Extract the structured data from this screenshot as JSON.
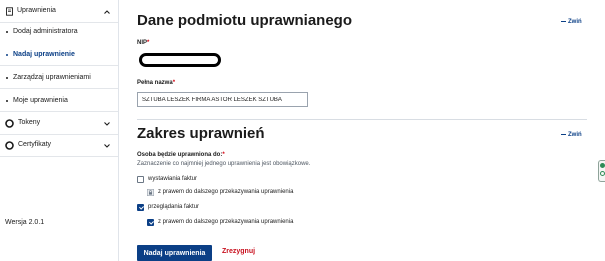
{
  "sidebar": {
    "header_label": "Uprawnienia",
    "items": [
      {
        "label": "Dodaj administratora"
      },
      {
        "label": "Nadaj uprawnienie"
      },
      {
        "label": "Zarządzaj uprawnieniami"
      },
      {
        "label": "Moje uprawnienia"
      }
    ],
    "active_item": "Nadaj uprawnienie",
    "groups": [
      {
        "label": "Tokeny",
        "icon": "circle-icon"
      },
      {
        "label": "Certyfikaty",
        "icon": "circle-icon"
      }
    ],
    "version": "Wersja 2.0.1"
  },
  "subject_section": {
    "title": "Dane podmiotu uprawnianego",
    "collapse_label": "Zwiń",
    "nip_label": "NIP",
    "nip_required": "*",
    "name_label": "Pełna nazwa",
    "name_required": "*",
    "name_value": "SZTUBA LESZEK FIRMA ASTOR LESZEK SZTUBA"
  },
  "scope_section": {
    "title": "Zakres uprawnień",
    "collapse_label": "Zwiń",
    "person_label": "Osoba będzie uprawniona do:",
    "person_required": "*",
    "hint": "Zaznaczenie co najmniej jednego uprawnienia jest obowiązkowe.",
    "options": [
      {
        "label": "wystawiania faktur",
        "checked": false
      },
      {
        "label": "z prawem do dalszego przekazywania uprawnienia",
        "locked": true,
        "checked": false
      },
      {
        "label": "przeglądania faktur",
        "checked": true
      },
      {
        "label": "z prawem do dalszego przekazywania uprawnienia",
        "checked": true
      }
    ]
  },
  "actions": {
    "submit_label": "Nadaj uprawnienia",
    "cancel_label": "Zrezygnuj"
  },
  "colors": {
    "primary": "#0b3f86",
    "danger": "#c8101e",
    "required": "#d4000f"
  }
}
